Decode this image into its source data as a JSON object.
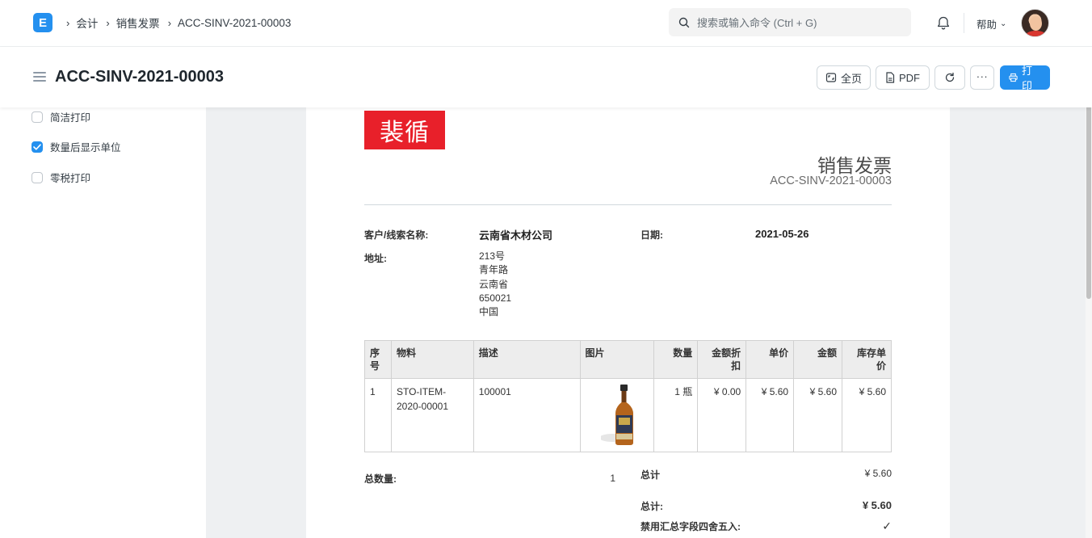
{
  "navbar": {
    "logo_letter": "E",
    "breadcrumbs": [
      "会计",
      "销售发票",
      "ACC-SINV-2021-00003"
    ],
    "search_placeholder": "搜索或输入命令 (Ctrl + G)",
    "help_label": "帮助"
  },
  "page": {
    "title": "ACC-SINV-2021-00003",
    "buttons": {
      "full_page": "全页",
      "pdf": "PDF",
      "print": "打印"
    }
  },
  "sidebar": {
    "options": [
      {
        "label": "简洁打印",
        "checked": false
      },
      {
        "label": "数量后显示单位",
        "checked": true
      },
      {
        "label": "零税打印",
        "checked": false
      }
    ]
  },
  "invoice": {
    "logo_text": "裴循",
    "heading": "销售发票",
    "number": "ACC-SINV-2021-00003",
    "customer_label": "客户/线索名称:",
    "customer_value": "云南省木材公司",
    "date_label": "日期:",
    "date_value": "2021-05-26",
    "address_label": "地址:",
    "address_lines": [
      "213号",
      "青年路",
      "云南省",
      "650021",
      "中国"
    ],
    "columns": [
      "序号",
      "物料",
      "描述",
      "图片",
      "数量",
      "金额折扣",
      "单价",
      "金额",
      "库存单价"
    ],
    "rows": [
      {
        "idx": "1",
        "item": "STO-ITEM-2020-00001",
        "description": "100001",
        "qty": "1 瓶",
        "discount": "¥ 0.00",
        "rate": "¥ 5.60",
        "amount": "¥ 5.60",
        "stock_rate": "¥ 5.60"
      }
    ],
    "total_qty_label": "总数量:",
    "total_qty_value": "1",
    "total_label": "总计",
    "total_value": "¥ 5.60",
    "grand_total_label": "总计:",
    "grand_total_value": "¥ 5.60",
    "disable_rounded_label": "禁用汇总字段四舍五入:",
    "disable_rounded_value": "✓"
  },
  "colors": {
    "primary": "#2490ef",
    "logo_red": "#e8202a",
    "preview_bg": "#eef0f2"
  }
}
